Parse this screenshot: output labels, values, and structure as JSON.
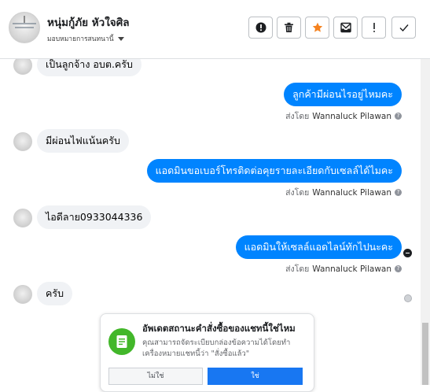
{
  "header": {
    "name": "หนุ่มกู้ภัย หัวใจศิล",
    "subtitle": "มอบหมายการสนทนานี้",
    "toolbar": [
      {
        "name": "alert-circle-icon"
      },
      {
        "name": "trash-icon"
      },
      {
        "name": "star-icon",
        "color": "#f5821f"
      },
      {
        "name": "archive-envelope-icon"
      },
      {
        "name": "exclamation-icon"
      },
      {
        "name": "checkmark-icon"
      }
    ]
  },
  "messages": [
    {
      "dir": "in",
      "text": "เป็นลูกจ้าง อบต.ครับ"
    },
    {
      "dir": "out",
      "text": "ลูกค้ามีผ่อนไรอยู่ไหมคะ",
      "sent_by_label": "ส่งโดย",
      "sender": "Wannaluck Pilawan"
    },
    {
      "dir": "in",
      "text": "มีผ่อนไฟแน้นครับ"
    },
    {
      "dir": "out",
      "text": "แอดมินขอเบอร์โทรติดต่อคุยรายละเอียดกับเซลล์ได้ไมคะ",
      "sent_by_label": "ส่งโดย",
      "sender": "Wannaluck Pilawan"
    },
    {
      "dir": "in",
      "text": "ไอดีลาย0933044336"
    },
    {
      "dir": "out",
      "text": "แอดมินให้เซลล์แอดไลน์ทักไปนะคะ",
      "sent_by_label": "ส่งโดย",
      "sender": "Wannaluck Pilawan"
    },
    {
      "dir": "in",
      "text": "ครับ"
    }
  ],
  "card": {
    "title": "อัพเดตสถานะคำสั่งซื้อของแชทนี้ใช่ไหม",
    "description": "คุณสามารถจัดระเบียบกล่องข้อความได้โดยทำเครื่องหมายแชทนี้ว่า \"สั่งซื้อแล้ว\"",
    "no_label": "ไม่ใช่",
    "yes_label": "ใช่"
  },
  "colors": {
    "outgoing_bubble": "#0084ff",
    "incoming_bubble": "#f0f2f5",
    "primary_button": "#1877f2",
    "card_icon": "#42b72a"
  }
}
